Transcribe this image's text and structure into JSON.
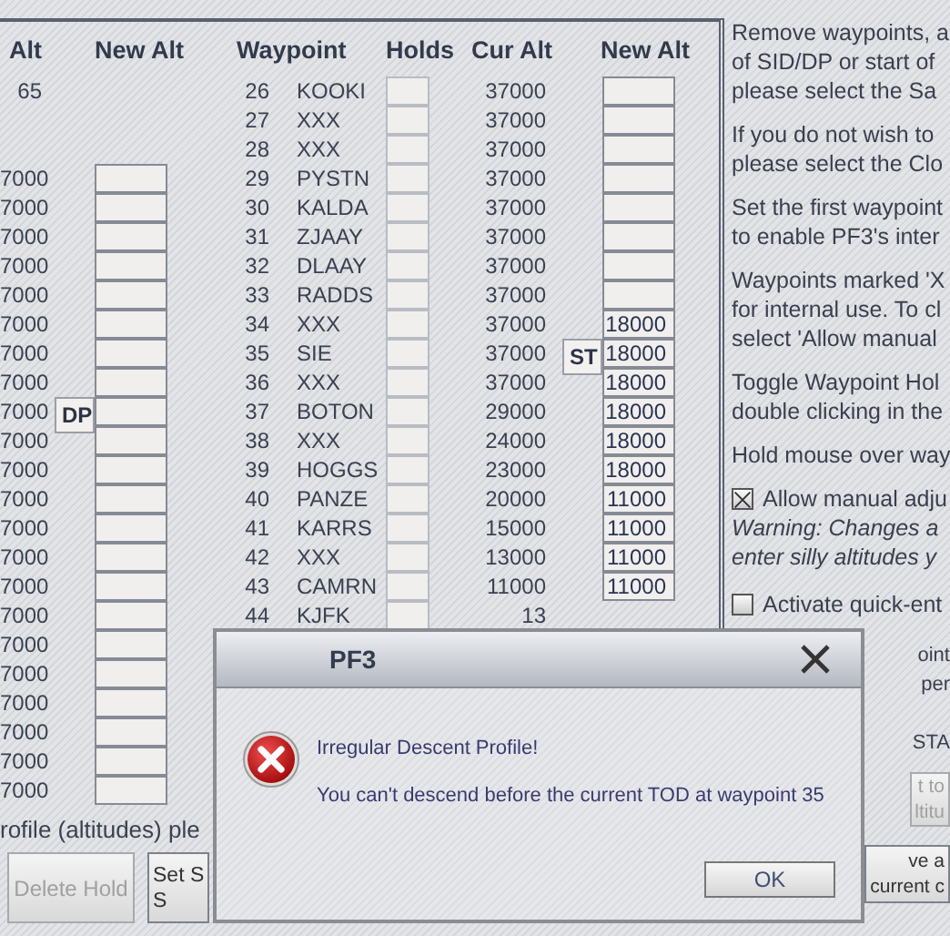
{
  "left_table": {
    "columns": [
      "Alt",
      "New Alt"
    ],
    "rows": [
      {
        "kind": "label",
        "cur_alt": "65"
      },
      {
        "kind": "blank"
      },
      {
        "kind": "blank"
      },
      {
        "kind": "input",
        "cur_alt": "7000"
      },
      {
        "kind": "input",
        "cur_alt": "7000"
      },
      {
        "kind": "input",
        "cur_alt": "7000"
      },
      {
        "kind": "input",
        "cur_alt": "7000"
      },
      {
        "kind": "input",
        "cur_alt": "7000"
      },
      {
        "kind": "input",
        "cur_alt": "7000"
      },
      {
        "kind": "input",
        "cur_alt": "7000"
      },
      {
        "kind": "input",
        "cur_alt": "7000"
      },
      {
        "kind": "input",
        "cur_alt": "7000",
        "marker": "DP"
      },
      {
        "kind": "input",
        "cur_alt": "7000"
      },
      {
        "kind": "input",
        "cur_alt": "7000"
      },
      {
        "kind": "input",
        "cur_alt": "7000"
      },
      {
        "kind": "input",
        "cur_alt": "7000"
      },
      {
        "kind": "input",
        "cur_alt": "7000"
      },
      {
        "kind": "input",
        "cur_alt": "7000"
      },
      {
        "kind": "input",
        "cur_alt": "7000"
      },
      {
        "kind": "input",
        "cur_alt": "7000"
      },
      {
        "kind": "input",
        "cur_alt": "7000"
      },
      {
        "kind": "input",
        "cur_alt": "7000"
      },
      {
        "kind": "input",
        "cur_alt": "7000"
      },
      {
        "kind": "input",
        "cur_alt": "7000"
      },
      {
        "kind": "input",
        "cur_alt": "7000"
      }
    ]
  },
  "waypoint_table": {
    "columns": [
      "Waypoint",
      "Holds",
      "Cur Alt",
      "New Alt"
    ],
    "rows": [
      {
        "number": "26",
        "waypoint": "KOOKI",
        "cur_alt": "37000",
        "kind": "input"
      },
      {
        "number": "27",
        "waypoint": "XXX",
        "cur_alt": "37000",
        "kind": "input"
      },
      {
        "number": "28",
        "waypoint": "XXX",
        "cur_alt": "37000",
        "kind": "input"
      },
      {
        "number": "29",
        "waypoint": "PYSTN",
        "cur_alt": "37000",
        "kind": "input"
      },
      {
        "number": "30",
        "waypoint": "KALDA",
        "cur_alt": "37000",
        "kind": "input"
      },
      {
        "number": "31",
        "waypoint": "ZJAAY",
        "cur_alt": "37000",
        "kind": "input"
      },
      {
        "number": "32",
        "waypoint": "DLAAY",
        "cur_alt": "37000",
        "kind": "input"
      },
      {
        "number": "33",
        "waypoint": "RADDS",
        "cur_alt": "37000",
        "kind": "input"
      },
      {
        "number": "34",
        "waypoint": "XXX",
        "cur_alt": "37000",
        "kind": "input",
        "new_alt": "18000"
      },
      {
        "number": "35",
        "waypoint": "SIE",
        "cur_alt": "37000",
        "kind": "input",
        "new_alt": "18000",
        "marker": "ST"
      },
      {
        "number": "36",
        "waypoint": "XXX",
        "cur_alt": "37000",
        "kind": "input",
        "new_alt": "18000"
      },
      {
        "number": "37",
        "waypoint": "BOTON",
        "cur_alt": "29000",
        "kind": "input",
        "new_alt": "18000"
      },
      {
        "number": "38",
        "waypoint": "XXX",
        "cur_alt": "24000",
        "kind": "input",
        "new_alt": "18000"
      },
      {
        "number": "39",
        "waypoint": "HOGGS",
        "cur_alt": "23000",
        "kind": "input",
        "new_alt": "18000"
      },
      {
        "number": "40",
        "waypoint": "PANZE",
        "cur_alt": "20000",
        "kind": "input",
        "new_alt": "11000"
      },
      {
        "number": "41",
        "waypoint": "KARRS",
        "cur_alt": "15000",
        "kind": "input",
        "new_alt": "11000"
      },
      {
        "number": "42",
        "waypoint": "XXX",
        "cur_alt": "13000",
        "kind": "input",
        "new_alt": "11000"
      },
      {
        "number": "43",
        "waypoint": "CAMRN",
        "cur_alt": "11000",
        "kind": "input",
        "new_alt": "11000"
      },
      {
        "number": "44",
        "waypoint": "KJFK",
        "cur_alt": "13",
        "kind": "none"
      }
    ]
  },
  "note": "rofile (altitudes) ple",
  "buttons": [
    {
      "lines": [
        "Delete Hold"
      ],
      "disabled": true
    },
    {
      "lines": [
        "Set S",
        "S"
      ],
      "disabled": false
    }
  ],
  "right_panel": {
    "paragraphs": [
      {
        "lines": [
          "Remove waypoints, a",
          "of SID/DP or start of",
          "please select the Sa"
        ]
      },
      {
        "lines": [
          "If you do not wish to",
          "please select the Clo"
        ]
      },
      {
        "lines": [
          "Set the first waypoint",
          "to enable PF3's inter"
        ]
      },
      {
        "lines": [
          "Waypoints marked 'X",
          "for internal use. To cl",
          "select 'Allow manual"
        ]
      },
      {
        "lines": [
          "Toggle Waypoint Hol",
          "double clicking in the"
        ]
      },
      {
        "lines": [
          "Hold mouse over way"
        ]
      }
    ],
    "options": [
      {
        "label": "Allow manual adju",
        "checked": true,
        "warning_lines": [
          "Warning: Changes a",
          "enter silly altitudes y"
        ]
      },
      {
        "label": "Activate quick-ent",
        "checked": false
      }
    ],
    "partial_lines": [
      {
        "lines": [
          "oint",
          "per"
        ]
      },
      {
        "lines": [
          "STA"
        ]
      }
    ],
    "buttons": [
      {
        "lines": [
          "t to",
          "ltitu"
        ],
        "disabled": true
      },
      {
        "lines": [
          "ve a",
          "current c"
        ],
        "disabled": false
      }
    ]
  },
  "dialog": {
    "title": "PF3",
    "lines": [
      "Irregular Descent Profile!",
      "You can't descend before the current TOD at waypoint 35"
    ],
    "button": "OK"
  }
}
